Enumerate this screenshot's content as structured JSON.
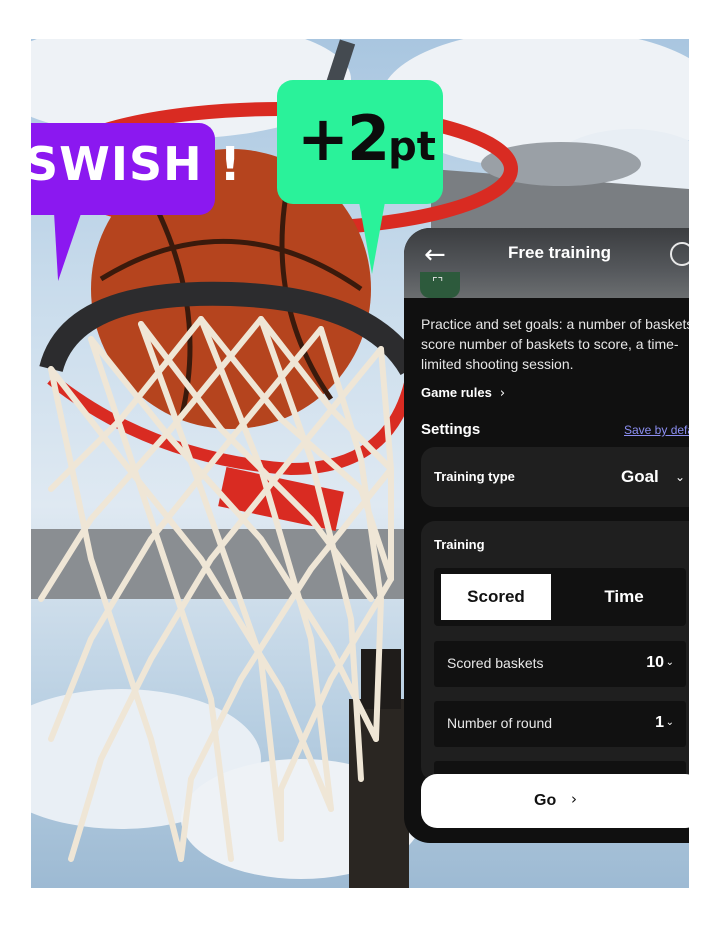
{
  "bubbles": {
    "swish": "SWISH !",
    "points_main": "+2",
    "points_unit": "pt",
    "swish_color": "#8b18f0",
    "points_color": "#2af29a"
  },
  "app": {
    "title": "Free training",
    "back_icon": "arrow-left-icon",
    "profile_icon": "user-face-icon"
  },
  "intro": {
    "lines": [
      "Practice and set goals: a number of baskets to",
      "score number of baskets to score, a time-",
      "limited shooting session."
    ]
  },
  "game_rules": {
    "label": "Game rules"
  },
  "settings": {
    "heading": "Settings",
    "save_default": "Save by default"
  },
  "training_type": {
    "label": "Training type",
    "value": "Goal"
  },
  "training": {
    "label": "Training",
    "segments": [
      "Scored",
      "Time"
    ],
    "selected": "Scored",
    "rows": [
      {
        "label": "Scored baskets",
        "value": "10"
      },
      {
        "label": "Number of round",
        "value": "1"
      }
    ]
  },
  "go_button": {
    "label": "Go"
  }
}
